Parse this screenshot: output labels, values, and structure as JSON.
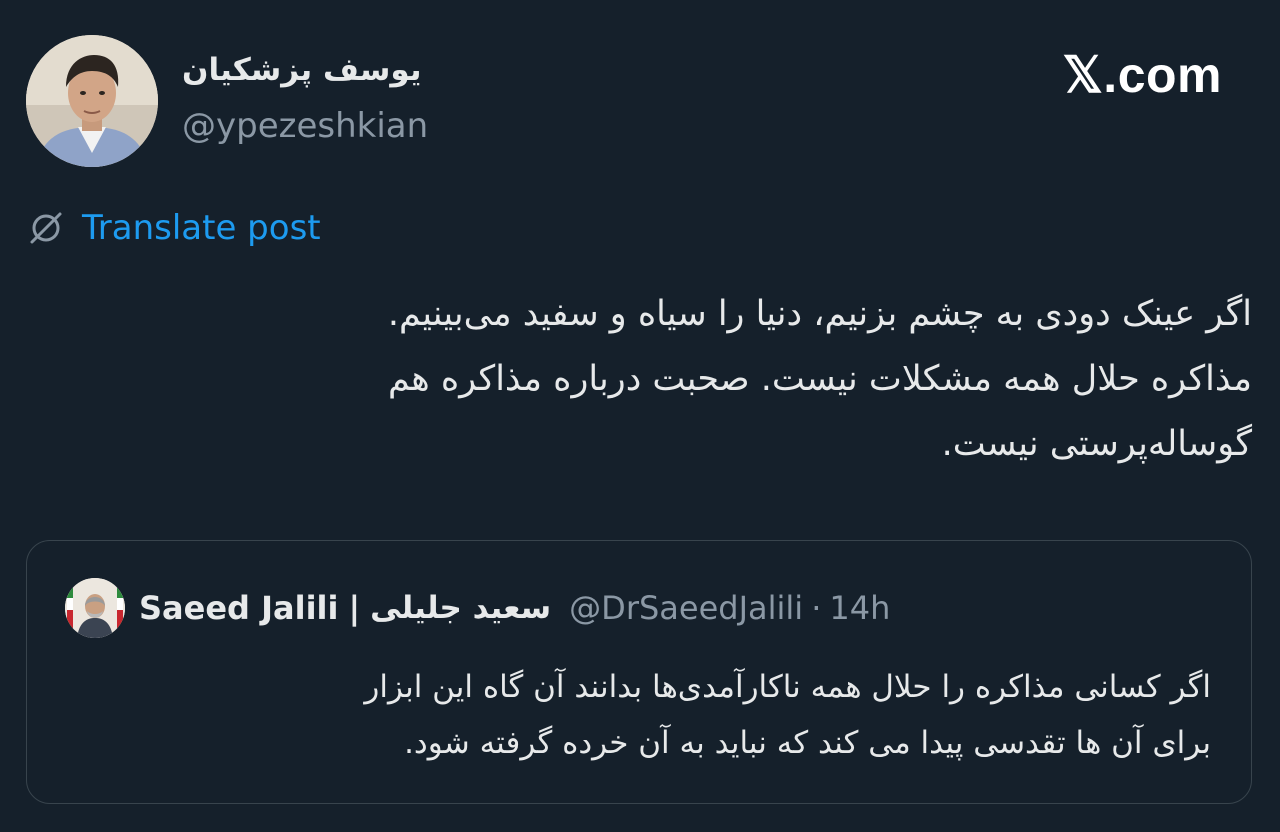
{
  "author": {
    "display_name": "یوسف پزشکیان",
    "handle": "@ypezeshkian"
  },
  "brand": {
    "label": "𝕏.com"
  },
  "translate": {
    "label": "Translate post",
    "icon": "globe-slash-icon"
  },
  "post": {
    "lines": [
      "اگر عینک دودی به چشم بزنیم، دنیا را سیاه و سفید می‌بینیم.",
      "مذاکره حلال همه مشکلات نیست. صحبت درباره مذاکره هم",
      "گوساله‌پرستی نیست."
    ]
  },
  "quoted": {
    "name_en": "Saeed Jalili",
    "separator": "|",
    "name_fa": "سعید جلیلی",
    "handle": "@DrSaeedJalili",
    "dot": "·",
    "time": "14h",
    "lines": [
      "اگر کسانی مذاکره را حلال همه ناکارآمدی‌ها بدانند آن گاه این ابزار",
      "برای آن ها تقدسی پیدا می کند که نباید به آن خرده گرفته شود."
    ]
  },
  "colors": {
    "background": "#15202b",
    "text": "#e7e9ea",
    "muted": "#8b98a5",
    "accent": "#1d9bf0",
    "border": "#38444d"
  }
}
